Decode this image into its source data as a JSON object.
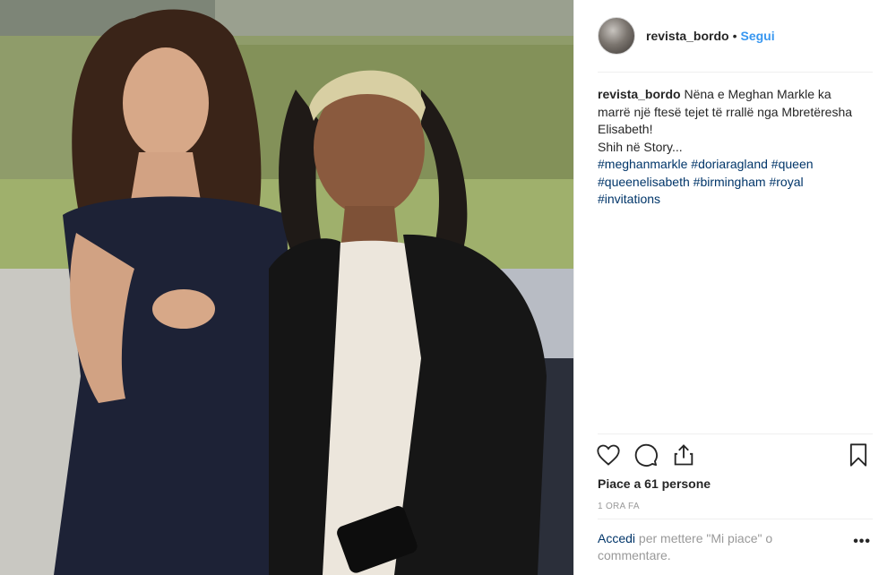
{
  "header": {
    "username": "revista_bordo",
    "separator": "•",
    "follow_label": "Segui"
  },
  "caption": {
    "username": "revista_bordo",
    "text_line1": "Nëna e Meghan Markle ka marrë një ftesë tejet të rrallë nga Mbretëresha Elisabeth!",
    "text_line2": "Shih në Story...",
    "hashtags": [
      "#meghanmarkle",
      "#doriaragland",
      "#queen",
      "#queenelisabeth",
      "#birmingham",
      "#royal",
      "#invitations"
    ]
  },
  "actions": {
    "icons": [
      "heart-icon",
      "comment-icon",
      "share-icon",
      "bookmark-icon"
    ]
  },
  "likes_text": "Piace a 61 persone",
  "timestamp": "1 ORA FA",
  "login_prompt": {
    "link": "Accedi",
    "rest": " per mettere \"Mi piace\" o commentare."
  },
  "more_label": "•••",
  "colors": {
    "link": "#003569",
    "follow": "#3897f0",
    "muted": "#999999",
    "text": "#262626"
  }
}
